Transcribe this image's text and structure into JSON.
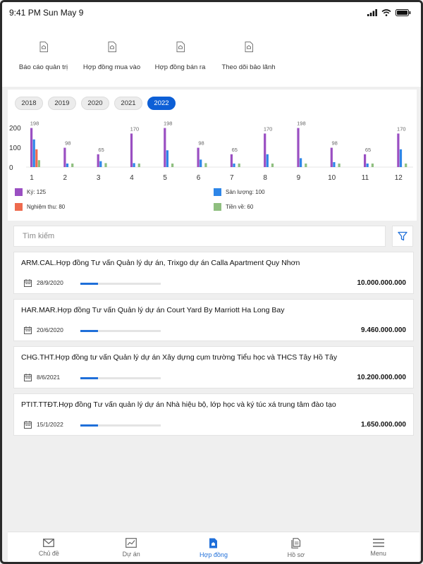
{
  "status_bar": {
    "time": "9:41 PM Sun May 9"
  },
  "top_menu": [
    {
      "label": "Báo cáo quản trị",
      "icon": "document-home-icon"
    },
    {
      "label": "Hợp đồng mua vào",
      "icon": "document-home-icon"
    },
    {
      "label": "Hợp đồng bán ra",
      "icon": "document-home-icon"
    },
    {
      "label": "Theo dõi bảo lãnh",
      "icon": "document-home-icon"
    }
  ],
  "years": {
    "items": [
      "2018",
      "2019",
      "2020",
      "2021",
      "2022"
    ],
    "selected": "2022"
  },
  "chart_data": {
    "type": "bar",
    "categories": [
      "1",
      "2",
      "3",
      "4",
      "5",
      "6",
      "7",
      "8",
      "9",
      "10",
      "11",
      "12"
    ],
    "series": [
      {
        "name": "Ký: 125",
        "color": "#9a4fc2",
        "values": [
          198,
          98,
          65,
          170,
          198,
          98,
          65,
          170,
          198,
          98,
          65,
          170
        ]
      },
      {
        "name": "Sản lượng: 100",
        "color": "#2e86e8",
        "values": [
          140,
          18,
          30,
          20,
          85,
          38,
          18,
          65,
          45,
          25,
          18,
          90
        ]
      },
      {
        "name": "Nghiệm thu: 80",
        "color": "#ee6a4e",
        "values": [
          90,
          0,
          0,
          0,
          0,
          0,
          0,
          0,
          0,
          0,
          0,
          0
        ]
      },
      {
        "name": "Tiền về: 60",
        "color": "#8fbf7f",
        "values": [
          35,
          18,
          20,
          18,
          18,
          20,
          18,
          18,
          18,
          18,
          18,
          18
        ]
      }
    ],
    "top_labels": [
      "198",
      "98",
      "65",
      "170",
      "198",
      "98",
      "65",
      "170",
      "198",
      "98",
      "65",
      "170"
    ],
    "yticks": [
      "200",
      "100",
      "0"
    ],
    "ylim": [
      0,
      200
    ]
  },
  "search": {
    "placeholder": "Tìm kiếm"
  },
  "contracts": [
    {
      "title": "ARM.CAL.Hợp đồng Tư vấn Quản lý dự án, Trixgo dự án Calla Apartment Quy Nhơn",
      "date": "28/9/2020",
      "progress": 0.22,
      "amount": "10.000.000.000"
    },
    {
      "title": "HAR.MAR.Hợp đồng Tư vấn Quản lý dự án Court Yard By Marriott Ha Long Bay",
      "date": "20/6/2020",
      "progress": 0.22,
      "amount": "9.460.000.000"
    },
    {
      "title": "CHG.THT.Hợp đồng tư vấn Quản lý dự án Xây dựng cụm trường Tiểu học và THCS Tây Hồ Tây",
      "date": "8/6/2021",
      "progress": 0.22,
      "amount": "10.200.000.000"
    },
    {
      "title": "PTIT.TTĐT.Hợp đồng Tư vấn quản lý dự án Nhà hiệu bộ, lớp học và ký túc xá trung tâm đào tạo",
      "date": "15/1/2022",
      "progress": 0.22,
      "amount": "1.650.000.000"
    }
  ],
  "tabs": [
    {
      "label": "Chủ đề",
      "icon": "mail-icon",
      "active": false
    },
    {
      "label": "Dự án",
      "icon": "chart-icon",
      "active": false
    },
    {
      "label": "Hợp đồng",
      "icon": "document-home-icon",
      "active": true
    },
    {
      "label": "Hồ sơ",
      "icon": "files-icon",
      "active": false
    },
    {
      "label": "Menu",
      "icon": "hamburger-icon",
      "active": false
    }
  ],
  "colors": {
    "accent": "#1f6fd9",
    "year_active": "#0d5fd6"
  }
}
